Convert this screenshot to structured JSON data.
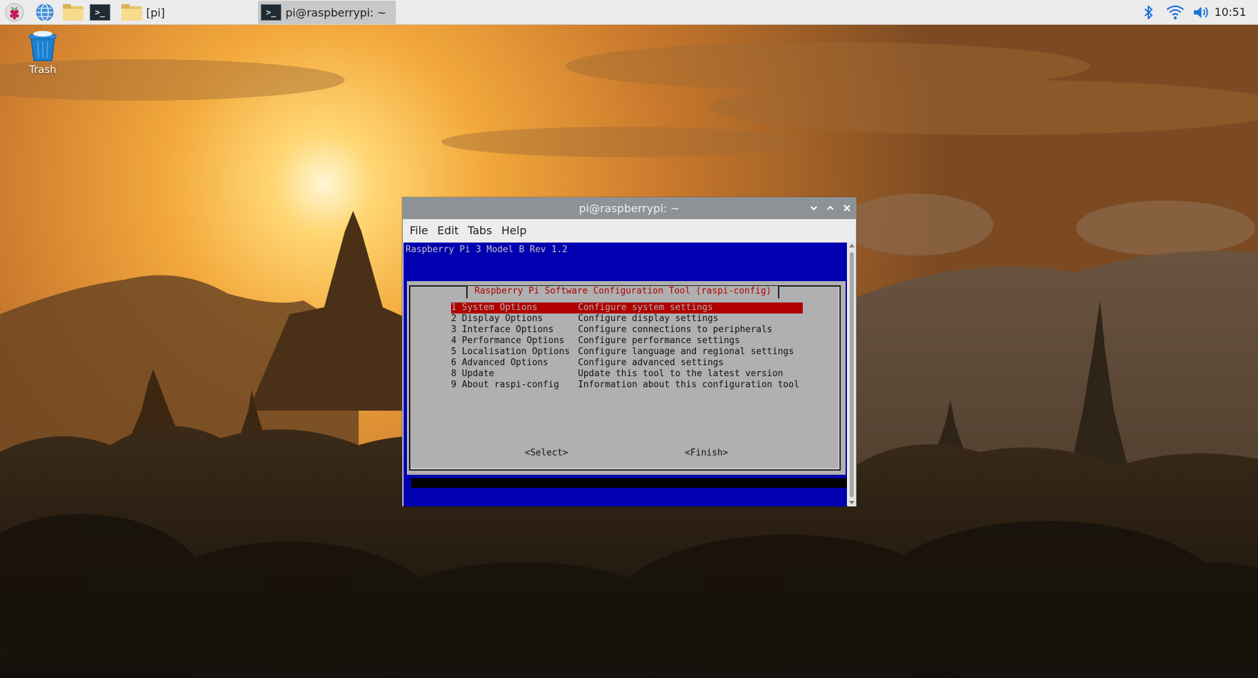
{
  "taskbar": {
    "launchers": [
      {
        "name": "raspberry-menu-icon"
      },
      {
        "name": "web-browser-icon"
      },
      {
        "name": "file-manager-icon"
      },
      {
        "name": "terminal-icon"
      }
    ],
    "tasks": [
      {
        "label": "[pi]",
        "icon": "folder-icon",
        "active": false
      },
      {
        "label": "pi@raspberrypi: ~",
        "icon": "terminal-icon",
        "active": true
      }
    ],
    "tray": [
      "bluetooth-icon",
      "wifi-icon",
      "volume-icon"
    ],
    "clock": "10:51"
  },
  "desktop": {
    "icons": [
      {
        "label": "Trash",
        "icon": "trash-icon"
      }
    ]
  },
  "terminal": {
    "title": "pi@raspberrypi: ~",
    "menu": [
      "File",
      "Edit",
      "Tabs",
      "Help"
    ],
    "model_line": "Raspberry Pi 3 Model B Rev 1.2",
    "dialog": {
      "title": "Raspberry Pi Software Configuration Tool (raspi-config)",
      "items": [
        {
          "key": "1 System Options",
          "desc": "Configure system settings",
          "selected": true
        },
        {
          "key": "2 Display Options",
          "desc": "Configure display settings",
          "selected": false
        },
        {
          "key": "3 Interface Options",
          "desc": "Configure connections to peripherals",
          "selected": false
        },
        {
          "key": "4 Performance Options",
          "desc": "Configure performance settings",
          "selected": false
        },
        {
          "key": "5 Localisation Options",
          "desc": "Configure language and regional settings",
          "selected": false
        },
        {
          "key": "6 Advanced Options",
          "desc": "Configure advanced settings",
          "selected": false
        },
        {
          "key": "8 Update",
          "desc": "Update this tool to the latest version",
          "selected": false
        },
        {
          "key": "9 About raspi-config",
          "desc": "Information about this configuration tool",
          "selected": false
        }
      ],
      "buttons": {
        "select": "<Select>",
        "finish": "<Finish>"
      }
    },
    "colors": {
      "screen_bg": "#0000b0",
      "dialog_bg": "#b0b0b0",
      "highlight": "#b00000"
    }
  }
}
